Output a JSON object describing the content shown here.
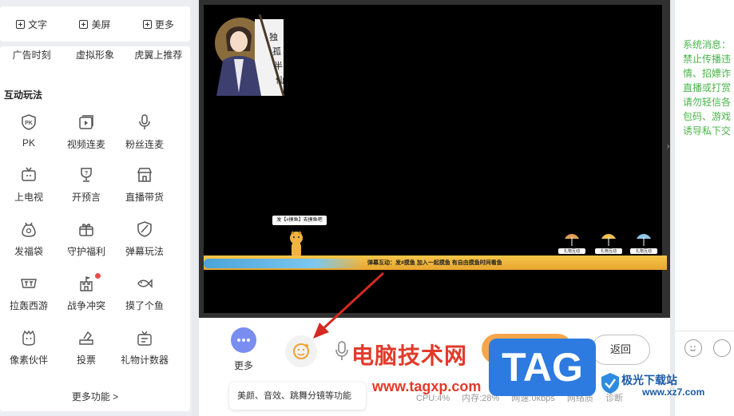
{
  "toolbar": {
    "text_label": "文字",
    "beauty_label": "美屏",
    "more_label": "更多"
  },
  "partial_row": [
    "广告时刻",
    "虚拟形象",
    "虎翼上推荐"
  ],
  "section": {
    "title": "互动玩法"
  },
  "features": [
    {
      "label": "PK",
      "icon": "pk-shield-icon"
    },
    {
      "label": "视频连麦",
      "icon": "video-link-icon"
    },
    {
      "label": "粉丝连麦",
      "icon": "microphone-icon"
    },
    {
      "label": "上电视",
      "icon": "tv-icon"
    },
    {
      "label": "开预言",
      "icon": "trophy-question-icon"
    },
    {
      "label": "直播带货",
      "icon": "shop-icon"
    },
    {
      "label": "发福袋",
      "icon": "lucky-bag-icon"
    },
    {
      "label": "守护福利",
      "icon": "gift-box-icon"
    },
    {
      "label": "弹幕玩法",
      "icon": "shield-check-icon"
    },
    {
      "label": "拉轰西游",
      "icon": "game-logo-icon"
    },
    {
      "label": "战争冲突",
      "icon": "castle-icon",
      "badge": true
    },
    {
      "label": "摸了个鱼",
      "icon": "fish-icon"
    },
    {
      "label": "像素伙伴",
      "icon": "pixel-pet-icon"
    },
    {
      "label": "投票",
      "icon": "vote-icon"
    },
    {
      "label": "礼物计数器",
      "icon": "gift-counter-icon"
    }
  ],
  "more_functions": "更多功能 >",
  "stage": {
    "banner_flag_text": "独孤半仙",
    "bubble_text": "发【#摸鱼】去摸鱼吧",
    "game_bar_text": "弹幕互动：发#摸鱼 加入一起摸鱼 有自由摸鱼时间看鱼",
    "gift_labels": [
      "礼物互动",
      "礼物互动",
      "礼物互动"
    ]
  },
  "controls": {
    "more_label": "更多",
    "back_label": "返回",
    "stats": [
      "CPU:4%",
      "内存:28%",
      "网速:0kbps",
      "网络质",
      "诊断"
    ]
  },
  "tooltip": "美颜、音效、跳舞分镜等功能",
  "system_message": [
    "系统消息：",
    "禁止传播违",
    "情、招嫖诈",
    "直播或打赏",
    "请勿轻信各",
    "包码、游戏",
    "诱导私下交"
  ],
  "watermark": {
    "site_text": "电脑技术网",
    "url": "www.tagxp.com",
    "tag": "TAG",
    "logo_text": "极光下载站",
    "logo_url": "www.xz7.com"
  },
  "colors": {
    "accent_green": "#49b449",
    "arrow_red": "#d42a22",
    "more_button": "#7a8df0",
    "watermark_blue": "#2d7be0"
  }
}
